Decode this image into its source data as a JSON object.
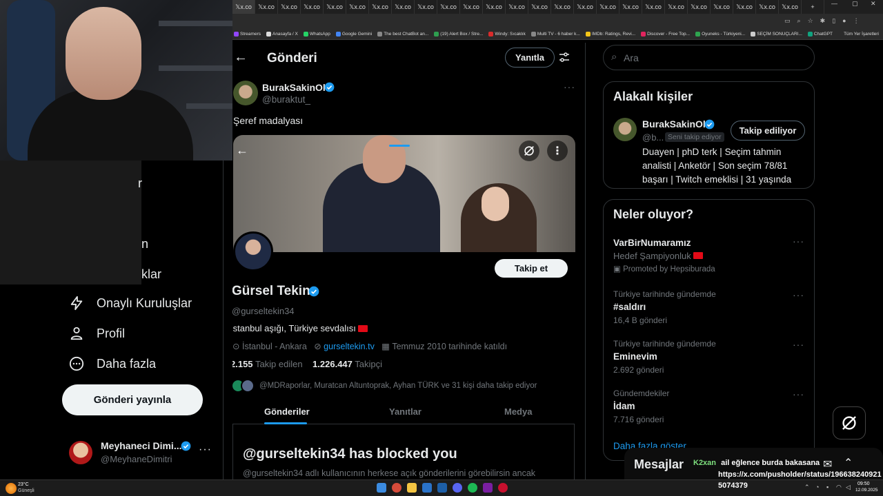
{
  "browser": {
    "tab_label": "x.co",
    "tab_count": 25,
    "bookmarks": [
      "Streamers",
      "Anasayfa / X",
      "WhatsApp",
      "Google Gemini",
      "The best ChatBot an...",
      "(19) Alert Box / Stre...",
      "Windy: Sıcaklık",
      "Multi TV - 6 haber k...",
      "IMDb: Ratings, Revi...",
      "Discover - Free Top...",
      "Oyuneks - Türkiyeni...",
      "SEÇİM SONUÇLARI...",
      "ChatGPT"
    ],
    "all_bookmarks": "Tüm Yer İşaretleri"
  },
  "nav": {
    "partial_items": [
      "r",
      "n",
      "klar"
    ],
    "items": [
      "Onaylı Kuruluşlar",
      "Profil",
      "Daha fazla"
    ],
    "post_button": "Gönderi yayınla",
    "account_name": "Meyhaneci Dimi...",
    "account_handle": "@MeyhaneDimitri"
  },
  "header": {
    "title": "Gönderi",
    "reply_button": "Yanıtla"
  },
  "post": {
    "author_name": "BurakSakinOl",
    "author_handle": "@buraktut_",
    "text": "Şeref madalyası"
  },
  "profile": {
    "follow_button": "Takip et",
    "name": "Gürsel Tekin",
    "handle": "@gurseltekin34",
    "bio": "İstanbul aşığı, Türkiye sevdalısı",
    "location": "İstanbul - Ankara",
    "website": "gurseltekin.tv",
    "joined": "Temmuz 2010 tarihinde katıldı",
    "following_count": "2.155",
    "following_label": "Takip edilen",
    "followers_count": "1.226.447",
    "followers_label": "Takipçi",
    "followed_by": "@MDRaporlar, Muratcan Altuntoprak, Ayhan TÜRK ve 31 kişi daha takip ediyor",
    "tabs": [
      "Gönderiler",
      "Yanıtlar",
      "Medya"
    ],
    "blocked_title": "@gurseltekin34 has blocked you",
    "blocked_text": "@gurseltekin34 adlı kullanıcının herkese açık gönderilerini görebilirsin ancak"
  },
  "search": {
    "placeholder": "Ara"
  },
  "related": {
    "title": "Alakalı kişiler",
    "name": "BurakSakinOl",
    "handle": "@b...",
    "follows_you": "Seni takip ediyor",
    "follow_state": "Takip ediliyor",
    "bio": "Duayen | phD terk | Seçim tahmin analisti | Anketör | Son seçim 78/81 başarı | Twitch emeklisi | 31 yaşında"
  },
  "trends": {
    "title": "Neler oluyor?",
    "promoted": {
      "name": "VarBirNumaramız",
      "sub": "Hedef Şampiyonluk",
      "label": "Promoted by Hepsiburada"
    },
    "items": [
      {
        "meta": "Türkiye tarihinde gündemde",
        "name": "#saldırı",
        "count": "16,4 B gönderi"
      },
      {
        "meta": "Türkiye tarihinde gündemde",
        "name": "Eminevim",
        "count": "2.692 gönderi"
      },
      {
        "meta": "Gündemdekiler",
        "name": "İdam",
        "count": "7.716 gönderi"
      }
    ],
    "show_more": "Daha fazla göster"
  },
  "overlay": {
    "messages": "Mesajlar",
    "chat_user": "K2xan",
    "chat_text": "ail eğlence burda bakasana",
    "chat_link": "https://x.com/pusholder/status/196638240921",
    "chat_link2": "5074379"
  },
  "taskbar": {
    "weather_temp": "23°C",
    "weather_text": "Güneşli",
    "time": "09:50",
    "date": "12.09.2025"
  },
  "colors": {
    "accent": "#1d9bf0",
    "verified": "#1d9bf0",
    "bg": "#000000",
    "border": "#2f3336"
  }
}
